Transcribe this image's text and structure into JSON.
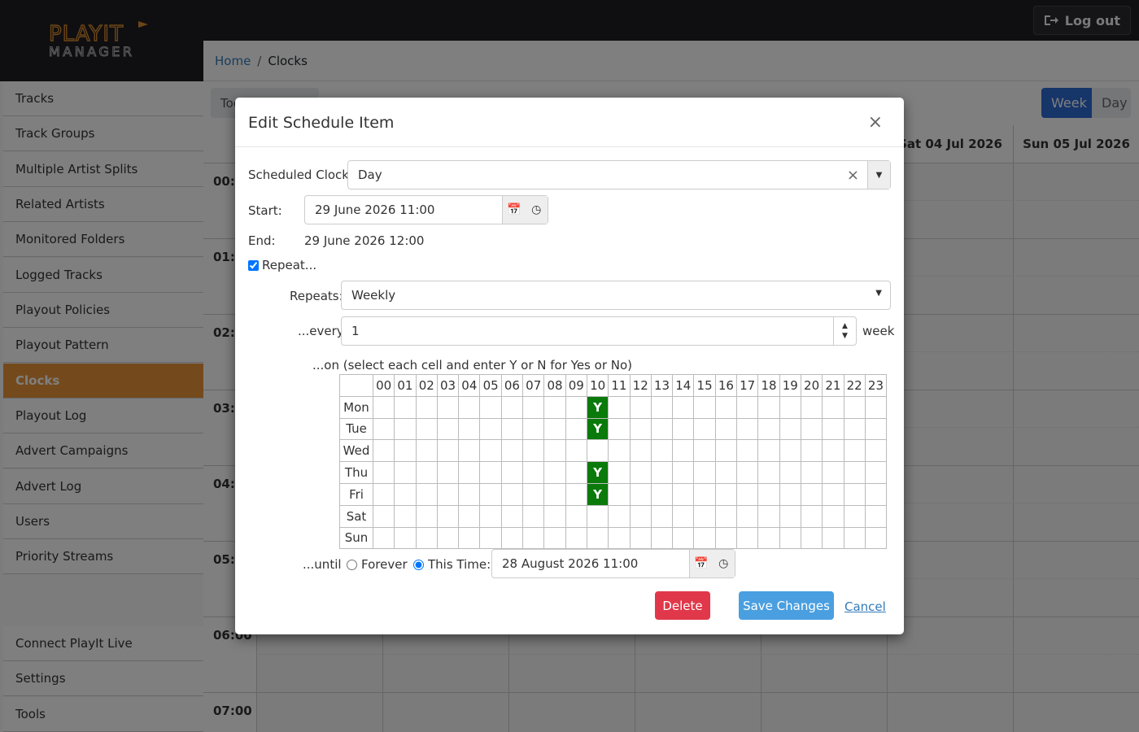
{
  "app": {
    "logo_text_top": "PLAYIT",
    "logo_text_bottom": "MANAGER",
    "logout_label": "Log out"
  },
  "breadcrumb": {
    "home": "Home",
    "current": "Clocks"
  },
  "sidebar": {
    "items": [
      {
        "label": "Tracks"
      },
      {
        "label": "Track Groups"
      },
      {
        "label": "Multiple Artist Splits"
      },
      {
        "label": "Related Artists"
      },
      {
        "label": "Monitored Folders"
      },
      {
        "label": "Logged Tracks"
      },
      {
        "label": "Playout Policies"
      },
      {
        "label": "Playout Pattern"
      },
      {
        "label": "Clocks"
      },
      {
        "label": "Playout Log"
      },
      {
        "label": "Advert Campaigns"
      },
      {
        "label": "Advert Log"
      },
      {
        "label": "Users"
      },
      {
        "label": "Priority Streams"
      }
    ],
    "bottom_items": [
      {
        "label": "Connect PlayIt Live"
      },
      {
        "label": "Settings"
      },
      {
        "label": "Tools"
      }
    ],
    "active_item": "Clocks",
    "active_color": "#e8953a"
  },
  "calendar": {
    "today_label": "Tod",
    "view_week": "Week",
    "view_day": "Day",
    "day_headers": [
      "Sat 04 Jul 2026",
      "Sun 05 Jul 2026"
    ],
    "hours": [
      "00:0",
      "01:0",
      "02:0",
      "03:0",
      "04:0",
      "05:0",
      "06:00",
      "07:00"
    ]
  },
  "modal": {
    "title": "Edit Schedule Item",
    "close": "×",
    "scheduled_clock_label": "Scheduled Clock:",
    "scheduled_clock_value": "Day",
    "start_label": "Start:",
    "start_value": "29 June 2026 11:00",
    "end_label": "End:",
    "end_value": "29 June 2026 12:00",
    "repeat_label": "Repeat...",
    "repeat_checked": true,
    "repeats_label": "Repeats:",
    "repeats_value": "Weekly",
    "every_label": "...every",
    "every_value": "1",
    "every_unit": "week",
    "on_label": "...on (select each cell and enter Y or N for Yes or No)",
    "hour_headers": [
      "00",
      "01",
      "02",
      "03",
      "04",
      "05",
      "06",
      "07",
      "08",
      "09",
      "10",
      "11",
      "12",
      "13",
      "14",
      "15",
      "16",
      "17",
      "18",
      "19",
      "20",
      "21",
      "22",
      "23"
    ],
    "days": [
      "Mon",
      "Tue",
      "Wed",
      "Thu",
      "Fri",
      "Sat",
      "Sun"
    ],
    "schedule": {
      "Mon": {
        "10": "Y"
      },
      "Tue": {
        "10": "Y"
      },
      "Thu": {
        "10": "Y"
      },
      "Fri": {
        "10": "Y"
      }
    },
    "until_label": "...until",
    "forever_label": "Forever",
    "this_time_label": "This Time:",
    "until_selected": "this_time",
    "until_value": "28 August 2026 11:00",
    "delete_label": "Delete",
    "save_label": "Save Changes",
    "cancel_label": "Cancel",
    "colors": {
      "delete": "#e0384a",
      "save": "#4a9fe0",
      "cell_on": "#0a7a0a"
    }
  }
}
